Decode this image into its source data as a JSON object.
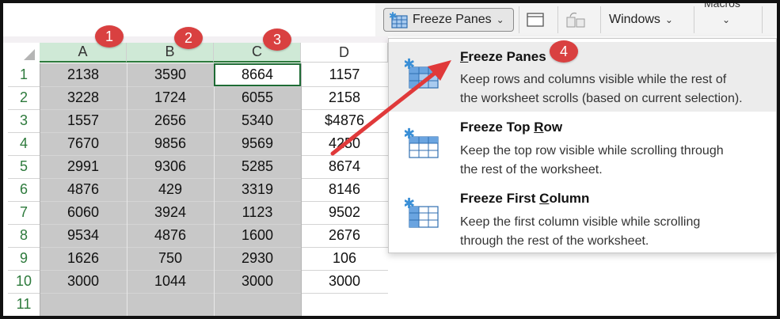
{
  "ribbon": {
    "freeze_panes_label": "Freeze Panes",
    "windows_label": "Windows",
    "macros_fragment": "Macros"
  },
  "columns": [
    "A",
    "B",
    "C",
    "D"
  ],
  "rows": [
    {
      "num": "1",
      "cells": [
        "2138",
        "3590",
        "8664",
        "1157"
      ]
    },
    {
      "num": "2",
      "cells": [
        "3228",
        "1724",
        "6055",
        "2158"
      ]
    },
    {
      "num": "3",
      "cells": [
        "1557",
        "2656",
        "5340",
        "$4876"
      ]
    },
    {
      "num": "4",
      "cells": [
        "7670",
        "9856",
        "9569",
        "4250"
      ]
    },
    {
      "num": "5",
      "cells": [
        "2991",
        "9306",
        "5285",
        "8674"
      ]
    },
    {
      "num": "6",
      "cells": [
        "4876",
        "429",
        "3319",
        "8146"
      ]
    },
    {
      "num": "7",
      "cells": [
        "6060",
        "3924",
        "1123",
        "9502"
      ]
    },
    {
      "num": "8",
      "cells": [
        "9534",
        "4876",
        "1600",
        "2676"
      ]
    },
    {
      "num": "9",
      "cells": [
        "1626",
        "750",
        "2930",
        "106"
      ]
    },
    {
      "num": "10",
      "cells": [
        "3000",
        "1044",
        "3000",
        "3000"
      ]
    },
    {
      "num": "11",
      "cells": [
        "",
        "",
        "",
        ""
      ]
    }
  ],
  "badges": [
    "1",
    "2",
    "3",
    "4"
  ],
  "menu": {
    "items": [
      {
        "title_first": "F",
        "title_rest": "reeze Panes",
        "desc_line1": "Keep rows and columns visible while the rest of",
        "desc_line2": "the worksheet scrolls (based on current selection)."
      },
      {
        "title_pre": "Freeze Top ",
        "title_u": "R",
        "title_post": "ow",
        "desc_line1": "Keep the top row visible while scrolling through",
        "desc_line2": "the rest of the worksheet."
      },
      {
        "title_pre": "Freeze First ",
        "title_u": "C",
        "title_post": "olumn",
        "desc_line1": "Keep the first column visible while scrolling",
        "desc_line2": "through the rest of the worksheet."
      }
    ]
  },
  "colors": {
    "selected_column_fill": "#c8c8c8",
    "selected_header_fill": "#cfe9d6",
    "row_number_color": "#2d7a3c",
    "badge_color": "#d94040",
    "arrow_color": "#e0393a",
    "icon_blue": "#3a8fd6"
  },
  "icons": [
    "freeze-panes-icon",
    "chevron-down-icon",
    "freeze-top-row-icon",
    "freeze-first-column-icon"
  ]
}
